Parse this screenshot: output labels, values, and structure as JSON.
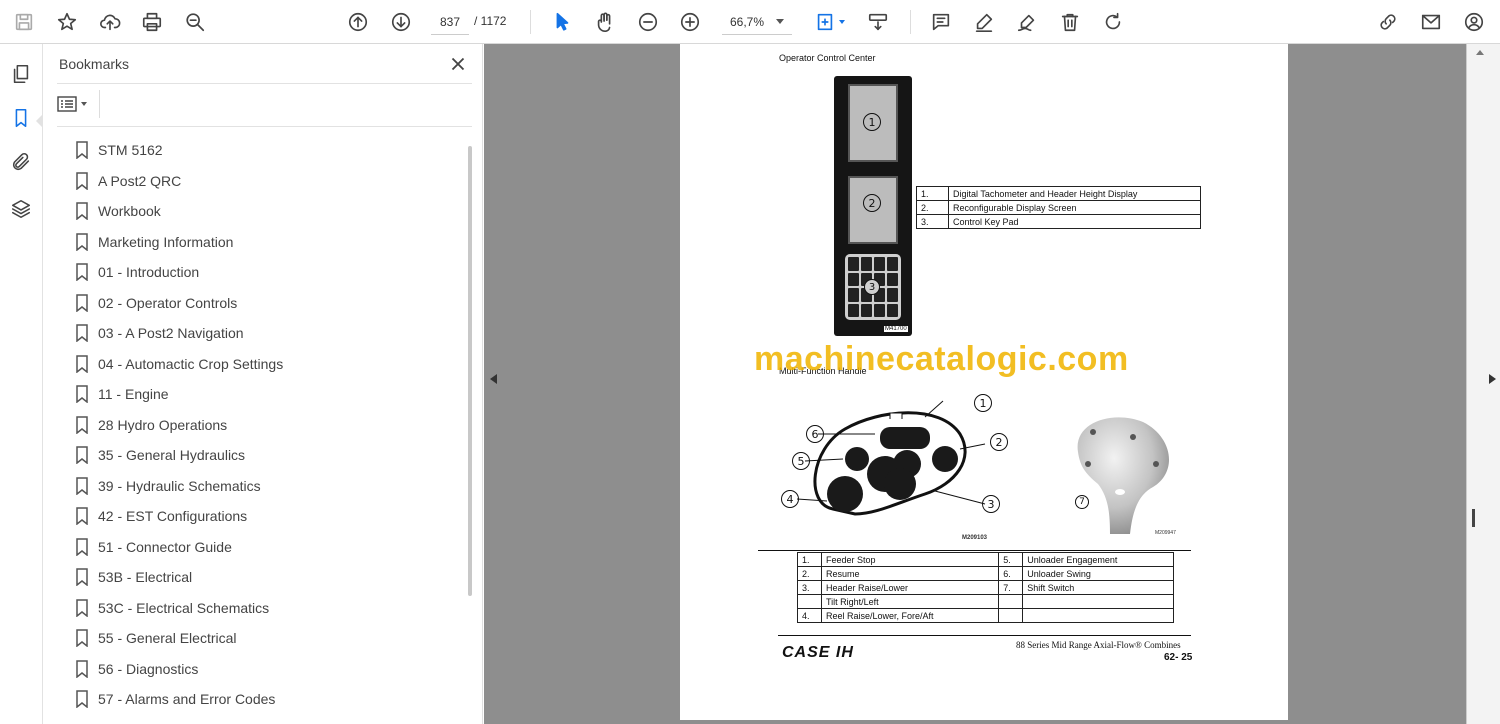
{
  "toolbar": {
    "page_current": "837",
    "page_total": "/ 1172",
    "zoom": "66,7%",
    "icons": [
      "save-icon",
      "bookmark-star-icon",
      "upload-cloud-icon",
      "print-icon",
      "zoom-search-icon",
      "page-up-icon",
      "page-down-icon",
      "select-cursor-icon",
      "hand-tool-icon",
      "zoom-out-icon",
      "zoom-in-icon",
      "fit-page-icon",
      "scroll-mode-icon",
      "comment-icon",
      "pen-highlight-icon",
      "sign-icon",
      "trash-icon",
      "rotate-icon",
      "link-share-icon",
      "email-icon",
      "account-icon"
    ]
  },
  "panel": {
    "title": "Bookmarks",
    "bookmarks": [
      "STM 5162",
      "A Post2 QRC",
      "Workbook",
      "Marketing Information",
      "01 - Introduction",
      "02 - Operator Controls",
      "03 - A Post2 Navigation",
      "04 - Automactic Crop Settings",
      "11 - Engine",
      "28 Hydro Operations",
      "35 - General Hydraulics",
      "39 - Hydraulic Schematics",
      "42 - EST Configurations",
      "51 - Connector Guide",
      "53B - Electrical",
      "53C - Electrical Schematics",
      "55 - General Electrical",
      "56 - Diagnostics",
      "57 - Alarms and Error Codes"
    ]
  },
  "document": {
    "heading1": "Operator Control Center",
    "control_code": "M41700",
    "control_legend": [
      [
        "1.",
        "Digital Tachometer and Header Height Display"
      ],
      [
        "2.",
        "Reconfigurable Display Screen"
      ],
      [
        "3.",
        "Control Key Pad"
      ]
    ],
    "watermark": "machinecatalogic.com",
    "heading2": "Multi-Function Handle",
    "handle_code": "M209103",
    "handle_side_code": "M209947",
    "callouts": [
      "1",
      "2",
      "3",
      "4",
      "5",
      "6",
      "7"
    ],
    "handle_legend": [
      [
        "1.",
        "Feeder Stop",
        "5.",
        "Unloader Engagement"
      ],
      [
        "2.",
        "Resume",
        "6.",
        "Unloader Swing"
      ],
      [
        "3.",
        "Header Raise/Lower",
        "7.",
        "Shift Switch"
      ],
      [
        "",
        "Tilt Right/Left",
        "",
        ""
      ],
      [
        "4.",
        "Reel Raise/Lower,  Fore/Aft",
        "",
        ""
      ]
    ],
    "brand": "CASE IH",
    "footer_series": "88 Series Mid Range Axial-Flow® Combines",
    "footer_page": "62- 25"
  },
  "colors": {
    "accent": "#1473e6",
    "doc_background": "#8e8e8e",
    "watermark": "#f0b400"
  }
}
